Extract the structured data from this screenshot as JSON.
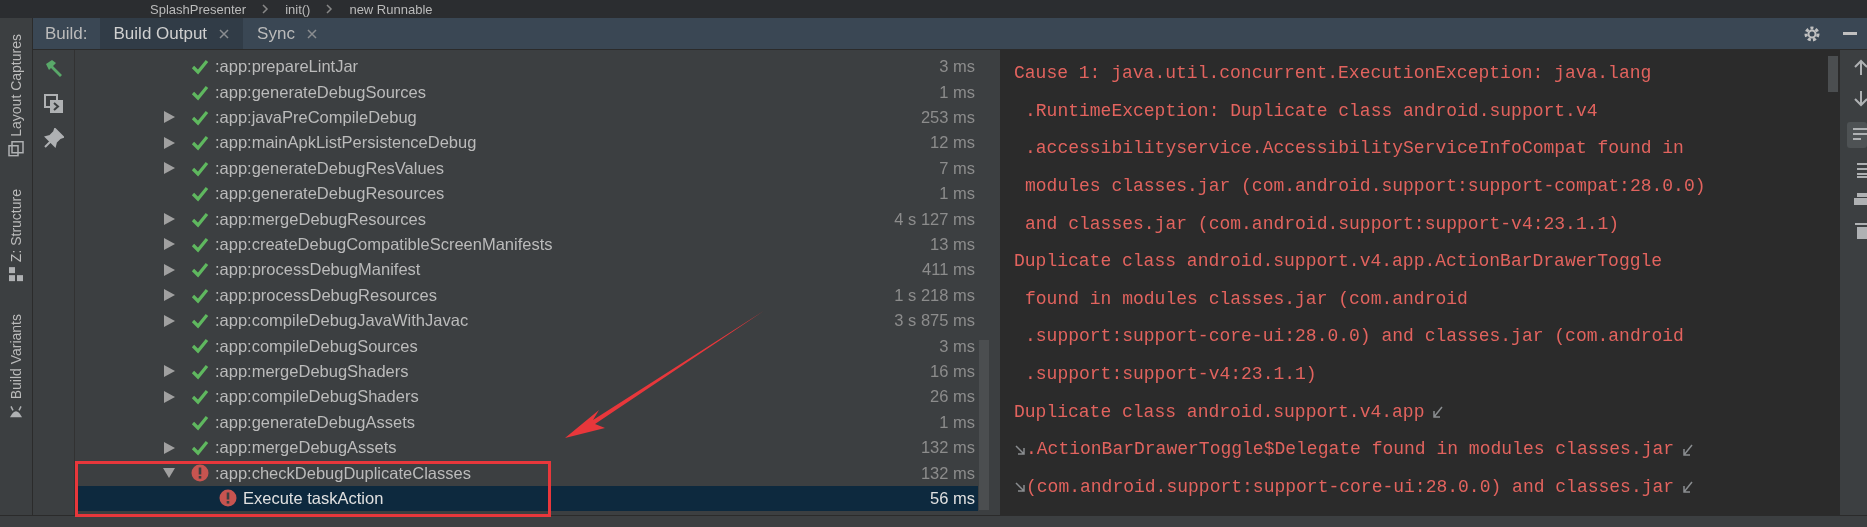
{
  "breadcrumbs": [
    "SplashPresenter",
    "init()",
    "new Runnable"
  ],
  "side_tabs": [
    {
      "label": "Layout Captures",
      "kind": "captures"
    },
    {
      "label": "Z: Structure",
      "kind": "structure"
    },
    {
      "label": "Build Variants",
      "kind": "variants"
    }
  ],
  "build_label": "Build:",
  "tabs": [
    {
      "label": "Build Output",
      "selected": true
    },
    {
      "label": "Sync",
      "selected": false
    }
  ],
  "tree": [
    {
      "label": ":app:prepareLintJar",
      "failed": false,
      "duration": "3 ms",
      "selected": false
    },
    {
      "label": ":app:generateDebugSources",
      "failed": false,
      "duration": "1 ms",
      "selected": false
    },
    {
      "label": ":app:javaPreCompileDebug",
      "failed": false,
      "duration": "253 ms",
      "expanded": false,
      "selected": false
    },
    {
      "label": ":app:mainApkListPersistenceDebug",
      "failed": false,
      "duration": "12 ms",
      "expanded": false,
      "selected": false
    },
    {
      "label": ":app:generateDebugResValues",
      "failed": false,
      "duration": "7 ms",
      "expanded": false,
      "selected": false
    },
    {
      "label": ":app:generateDebugResources",
      "failed": false,
      "duration": "1 ms",
      "selected": false
    },
    {
      "label": ":app:mergeDebugResources",
      "failed": false,
      "duration": "4 s 127 ms",
      "expanded": false,
      "selected": false
    },
    {
      "label": ":app:createDebugCompatibleScreenManifests",
      "failed": false,
      "duration": "13 ms",
      "expanded": false,
      "selected": false
    },
    {
      "label": ":app:processDebugManifest",
      "failed": false,
      "duration": "411 ms",
      "expanded": false,
      "selected": false
    },
    {
      "label": ":app:processDebugResources",
      "failed": false,
      "duration": "1 s 218 ms",
      "expanded": false,
      "selected": false
    },
    {
      "label": ":app:compileDebugJavaWithJavac",
      "failed": false,
      "duration": "3 s 875 ms",
      "expanded": false,
      "selected": false
    },
    {
      "label": ":app:compileDebugSources",
      "failed": false,
      "duration": "3 ms",
      "selected": false
    },
    {
      "label": ":app:mergeDebugShaders",
      "failed": false,
      "duration": "16 ms",
      "expanded": false,
      "selected": false
    },
    {
      "label": ":app:compileDebugShaders",
      "failed": false,
      "duration": "26 ms",
      "expanded": false,
      "selected": false
    },
    {
      "label": ":app:generateDebugAssets",
      "failed": false,
      "duration": "1 ms",
      "selected": false
    },
    {
      "label": ":app:mergeDebugAssets",
      "failed": false,
      "duration": "132 ms",
      "expanded": false,
      "selected": false
    },
    {
      "label": ":app:checkDebugDuplicateClasses",
      "failed": true,
      "duration": "132 ms",
      "expanded": true,
      "selected": false,
      "children": [
        {
          "label": "Execute taskAction",
          "failed": true,
          "duration": "56 ms",
          "selected": true
        }
      ]
    }
  ],
  "console": [
    {
      "text": "Cause 1: java.util.concurrent.ExecutionException: java.lang",
      "continuation": false
    },
    {
      "text": ".RuntimeException: Duplicate class android.support.v4",
      "continuation": true
    },
    {
      "text": ".accessibilityservice.AccessibilityServiceInfoCompat found in",
      "continuation": true
    },
    {
      "text": "modules classes.jar (com.android.support:support-compat:28.0.0)",
      "continuation": true
    },
    {
      "text": "and classes.jar (com.android.support:support-v4:23.1.1)",
      "continuation": true
    },
    {
      "text": "Duplicate class android.support.v4.app.ActionBarDrawerToggle",
      "continuation": false
    },
    {
      "text": "found in modules classes.jar (com.android",
      "continuation": true
    },
    {
      "text": ".support:support-core-ui:28.0.0) and classes.jar (com.android",
      "continuation": true
    },
    {
      "text": ".support:support-v4:23.1.1)",
      "continuation": true
    },
    {
      "text": "Duplicate class android.support.v4.app",
      "continuation": false,
      "wrap_end": true
    },
    {
      "text": ".ActionBarDrawerToggle$Delegate found in modules classes.jar",
      "continuation": false,
      "wrap_start": true,
      "wrap_end": true
    },
    {
      "text": "(com.android.support:support-core-ui:28.0.0) and classes.jar",
      "continuation": false,
      "wrap_start": true,
      "wrap_end": true
    }
  ]
}
